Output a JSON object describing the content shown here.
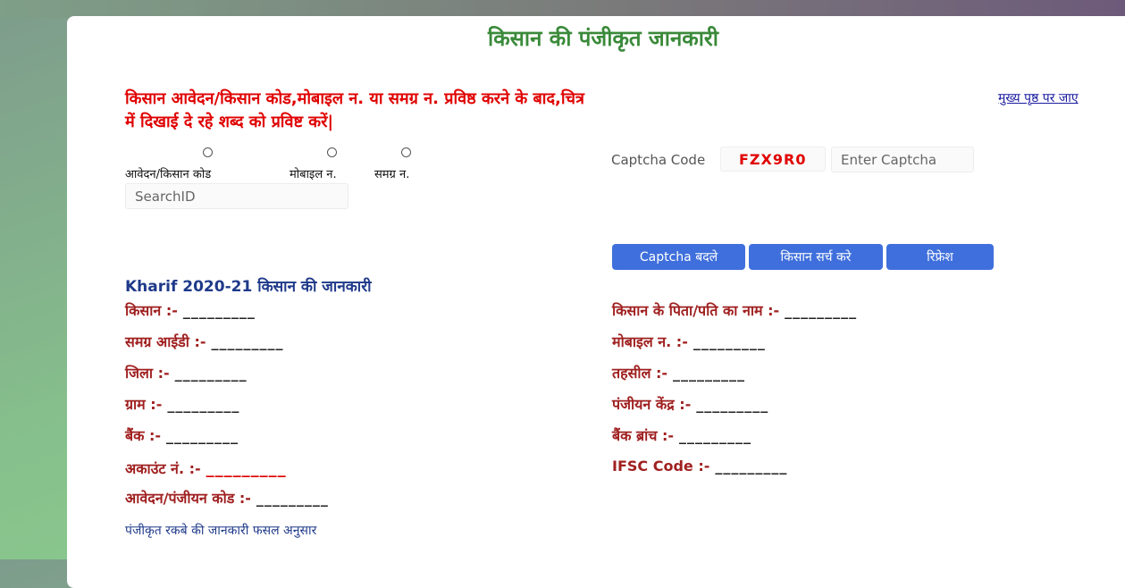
{
  "page_title": "किसान की पंजीकृत जानकारी",
  "instruction": "किसान आवेदन/किसान कोड,मोबाइल न. या समग्र न. प्रविष्ठ करने के बाद,चित्र में दिखाई दे रहे शब्द को प्रविष्ट करें|",
  "home_link": "मुख्य पृष्ठ पर जाए",
  "search_options": [
    {
      "label": "आवेदन/किसान कोड"
    },
    {
      "label": "मोबाइल न."
    },
    {
      "label": "समग्र न."
    }
  ],
  "search_input": {
    "placeholder": "SearchID",
    "value": ""
  },
  "captcha": {
    "label": "Captcha Code",
    "code": "FZX9R0",
    "input_placeholder": "Enter Captcha"
  },
  "buttons": {
    "change_captcha": "Captcha बदले",
    "search_farmer": "किसान सर्च करे",
    "refresh": "रिफ्रेश"
  },
  "section_title": "Kharif 2020-21 किसान की जानकारी",
  "fields_left": [
    {
      "label": "किसान :-",
      "value": "_________"
    },
    {
      "label": "समग्र आईडी :-",
      "value": "_________"
    },
    {
      "label": "जिला :-",
      "value": "_________"
    },
    {
      "label": "ग्राम :-",
      "value": "_________"
    },
    {
      "label": "बैंक :-",
      "value": "_________"
    },
    {
      "label": "अकाउंट नं. :-",
      "value": "_________"
    },
    {
      "label": "आवेदन/पंजीयन कोड :-",
      "value": "_________"
    }
  ],
  "fields_right": [
    {
      "label": "किसान के पिता/पति का नाम :-",
      "value": "_________"
    },
    {
      "label": "मोबाइल न. :-",
      "value": "_________"
    },
    {
      "label": "तहसील :-",
      "value": "_________"
    },
    {
      "label": "पंजीयन केंद्र :-",
      "value": "_________"
    },
    {
      "label": "बैंक ब्रांच :-",
      "value": "_________"
    },
    {
      "label": "IFSC Code :-",
      "value": "_________"
    }
  ],
  "footer_note": "पंजीकृत रकबे की जानकारी फसल अनुसार",
  "colors": {
    "title_green": "#3a8a3a",
    "instruction_red": "#e00000",
    "button_blue": "#3f6fdc",
    "label_maroon": "#a02020",
    "section_blue": "#1f3a8a"
  }
}
